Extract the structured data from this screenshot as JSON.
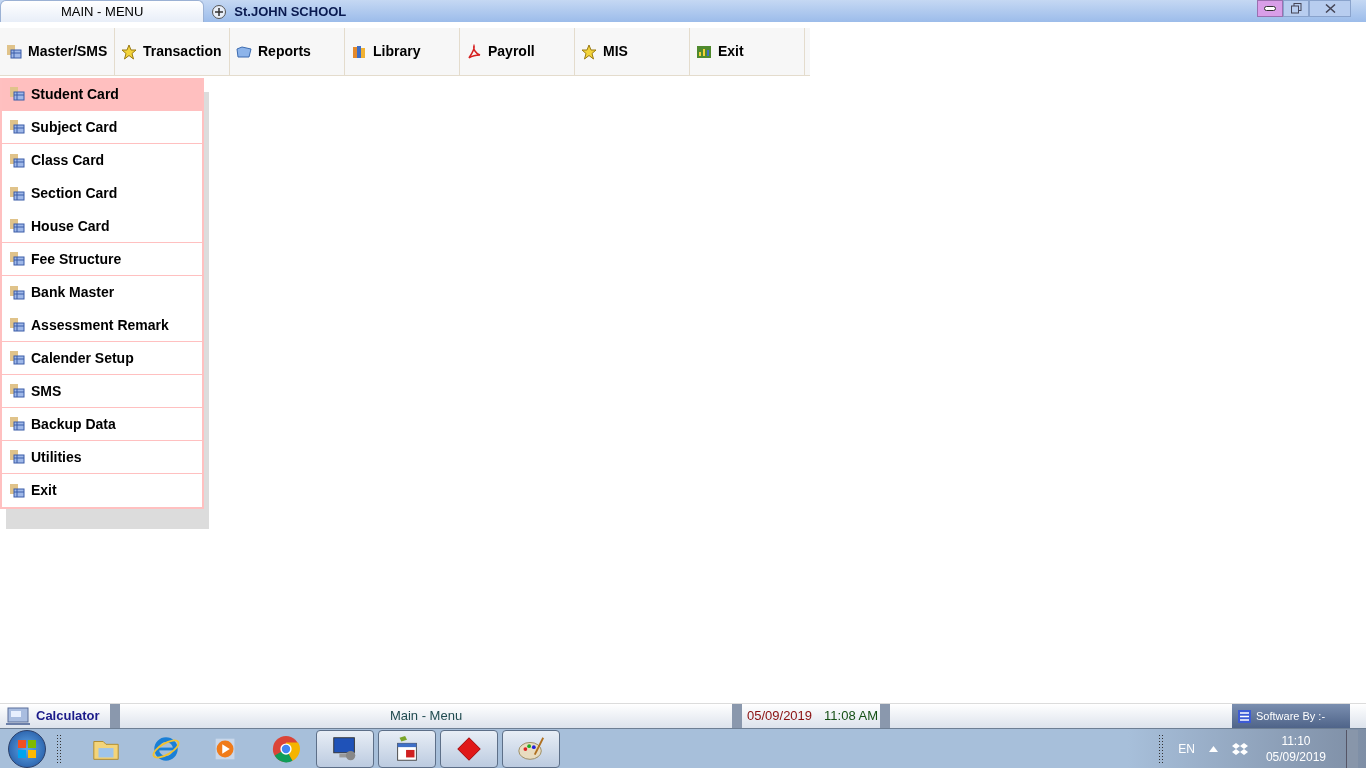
{
  "tabs": [
    {
      "label": "MAIN - MENU",
      "selected": true
    },
    {
      "label": "St.JOHN SCHOOL",
      "selected": false
    }
  ],
  "menu_bar": [
    {
      "label": "Master/SMS",
      "kind": "table"
    },
    {
      "label": "Transaction",
      "kind": "star"
    },
    {
      "label": "Reports",
      "kind": "folder"
    },
    {
      "label": "Library",
      "kind": "books"
    },
    {
      "label": "Payroll",
      "kind": "pdf"
    },
    {
      "label": "MIS",
      "kind": "star"
    },
    {
      "label": "Exit",
      "kind": "chart"
    }
  ],
  "dropdown": [
    {
      "label": "Student Card",
      "selected": true,
      "divider_after": true
    },
    {
      "label": "Subject Card",
      "selected": false,
      "divider_after": true
    },
    {
      "label": "Class Card",
      "selected": false,
      "divider_after": false
    },
    {
      "label": "Section Card",
      "selected": false,
      "divider_after": false
    },
    {
      "label": "House Card",
      "selected": false,
      "divider_after": true
    },
    {
      "label": "Fee Structure",
      "selected": false,
      "divider_after": true
    },
    {
      "label": "Bank Master",
      "selected": false,
      "divider_after": false
    },
    {
      "label": "Assessment Remark",
      "selected": false,
      "divider_after": true
    },
    {
      "label": "Calender Setup",
      "selected": false,
      "divider_after": true
    },
    {
      "label": "SMS",
      "selected": false,
      "divider_after": true
    },
    {
      "label": "Backup Data",
      "selected": false,
      "divider_after": true
    },
    {
      "label": "Utilities",
      "selected": false,
      "divider_after": true
    },
    {
      "label": "Exit",
      "selected": false,
      "divider_after": false
    }
  ],
  "status_bar": {
    "calculator": "Calculator",
    "title": "Main - Menu",
    "date": "05/09/2019",
    "time": "11:08 AM",
    "credit": "Software By :-"
  },
  "taskbar": {
    "apps": [
      {
        "kind": "folder",
        "pinned": true
      },
      {
        "kind": "browser",
        "pinned": true
      },
      {
        "kind": "media",
        "pinned": true
      },
      {
        "kind": "chrome",
        "pinned": true
      },
      {
        "kind": "remote",
        "pinned": false
      },
      {
        "kind": "calendar",
        "pinned": false
      },
      {
        "kind": "diamond",
        "pinned": false
      },
      {
        "kind": "paint",
        "pinned": false
      }
    ],
    "language": "EN",
    "clock_time": "11:10",
    "clock_date": "05/09/2019"
  }
}
